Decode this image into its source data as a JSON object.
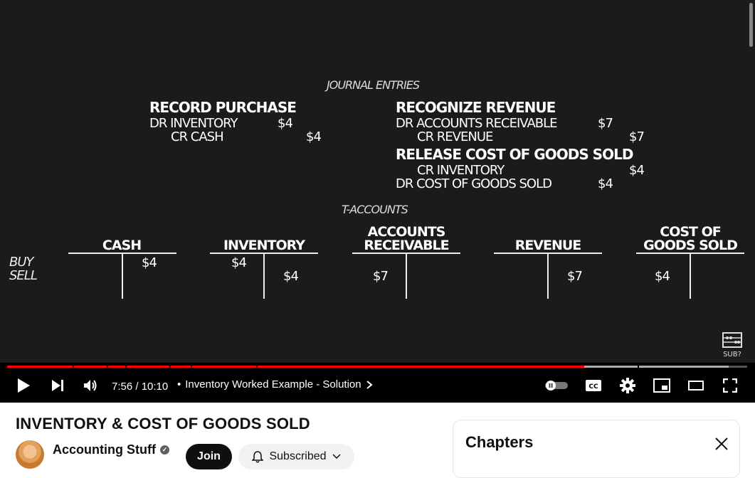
{
  "video": {
    "journal_heading": "JOURNAL ENTRIES",
    "record_purchase": {
      "title": "RECORD PURCHASE",
      "line1": "DR INVENTORY",
      "line1_amt": "$4",
      "line2": "CR CASH",
      "line2_amt": "$4"
    },
    "recognize_revenue": {
      "title": "RECOGNIZE REVENUE",
      "line1": "DR ACCOUNTS RECEIVABLE",
      "line1_amt": "$7",
      "line2": "CR REVENUE",
      "line2_amt": "$7"
    },
    "release_cogs": {
      "title": "RELEASE COST OF GOODS SOLD",
      "line1": "CR INVENTORY",
      "line1_amt": "$4",
      "line2": "DR COST OF GOODS SOLD",
      "line2_amt": "$4"
    },
    "taccounts_heading": "T-ACCOUNTS",
    "row_labels": {
      "buy": "BUY",
      "sell": "SELL"
    },
    "accounts": {
      "cash": {
        "title": "CASH",
        "right_buy": "$4"
      },
      "inventory": {
        "title": "INVENTORY",
        "left_buy": "$4",
        "right_sell": "$4"
      },
      "ar": {
        "title1": "ACCOUNTS",
        "title2": "RECEIVABLE",
        "left_sell": "$7"
      },
      "revenue": {
        "title": "REVENUE",
        "right_sell": "$7"
      },
      "cogs": {
        "title1": "COST OF",
        "title2": "GOODS SOLD",
        "left_sell": "$4"
      }
    },
    "sub_badge": "SUB?"
  },
  "player": {
    "time": "7:56 / 10:10",
    "chapter_title": "Inventory Worked Example - Solution",
    "chapter_separator": "•",
    "progress_fraction": 0.78,
    "colors": {
      "played": "#ff0000",
      "buffered": "#aaaaaa",
      "unplayed": "#555555"
    }
  },
  "video_title": "INVENTORY & COST OF GOODS SOLD",
  "channel": {
    "name": "Accounting Stuff",
    "join_label": "Join",
    "subscribed_label": "Subscribed"
  },
  "chapters_panel": {
    "title": "Chapters"
  }
}
